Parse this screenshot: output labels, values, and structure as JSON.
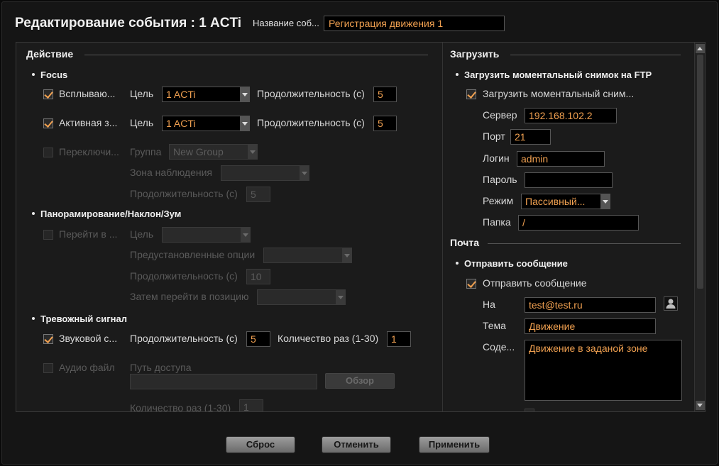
{
  "header": {
    "title": "Редактирование события : 1 ACTi",
    "name_label": "Название соб...",
    "name_value": "Регистрация движения 1"
  },
  "action": {
    "title": "Действие",
    "focus": {
      "title": "Focus",
      "popup": {
        "label": "Всплываю...",
        "checked": true,
        "target_label": "Цель",
        "target_value": "1 ACTi",
        "duration_label": "Продолжительность (с)",
        "duration_value": "5"
      },
      "active": {
        "label": "Активная з...",
        "checked": true,
        "target_label": "Цель",
        "target_value": "1 ACTi",
        "duration_label": "Продолжительность (с)",
        "duration_value": "5"
      },
      "switch": {
        "label": "Переключи...",
        "checked": false,
        "group_label": "Группа",
        "group_value": "New Group",
        "zone_label": "Зона наблюдения",
        "zone_value": "",
        "duration_label": "Продолжительность (с)",
        "duration_value": "5"
      }
    },
    "ptz": {
      "title": "Панорамирование/Наклон/Зум",
      "goto_label": "Перейти в ...",
      "target_label": "Цель",
      "target_value": "",
      "preset_label": "Предустановленные опции",
      "preset_value": "",
      "duration_label": "Продолжительность (с)",
      "duration_value": "10",
      "then_label": "Затем перейти в позицию",
      "then_value": ""
    },
    "alarm": {
      "title": "Тревожный сигнал",
      "sound_label": "Звуковой с...",
      "sound_checked": true,
      "duration_label": "Продолжительность (с)",
      "duration_value": "5",
      "count_label": "Количество раз (1-30)",
      "count_value": "1",
      "audio_label": "Аудио файл",
      "path_label": "Путь доступа",
      "path_value": "",
      "browse_label": "Обзор",
      "count2_label": "Количество раз (1-30)",
      "count2_value": "1"
    }
  },
  "upload": {
    "title": "Загрузить",
    "ftp": {
      "title": "Загрузить моментальный снимок на FTP",
      "enable_label": "Загрузить моментальный сним...",
      "enable_checked": true,
      "server_label": "Сервер",
      "server_value": "192.168.102.2",
      "port_label": "Порт",
      "port_value": "21",
      "login_label": "Логин",
      "login_value": "admin",
      "password_label": "Пароль",
      "password_value": "",
      "mode_label": "Режим",
      "mode_value": "Пассивный...",
      "folder_label": "Папка",
      "folder_value": "/"
    }
  },
  "mail": {
    "title": "Почта",
    "send": {
      "title": "Отправить сообщение",
      "enable_label": "Отправить сообщение",
      "enable_checked": true,
      "to_label": "На",
      "to_value": "test@test.ru",
      "subject_label": "Тема",
      "subject_value": "Движение",
      "content_label": "Соде...",
      "content_value": "Движение в заданой зоне"
    }
  },
  "footer": {
    "reset": "Сброс",
    "cancel": "Отменить",
    "apply": "Применить"
  },
  "colors": {
    "accent_text": "#f0a050",
    "background": "#151515"
  }
}
